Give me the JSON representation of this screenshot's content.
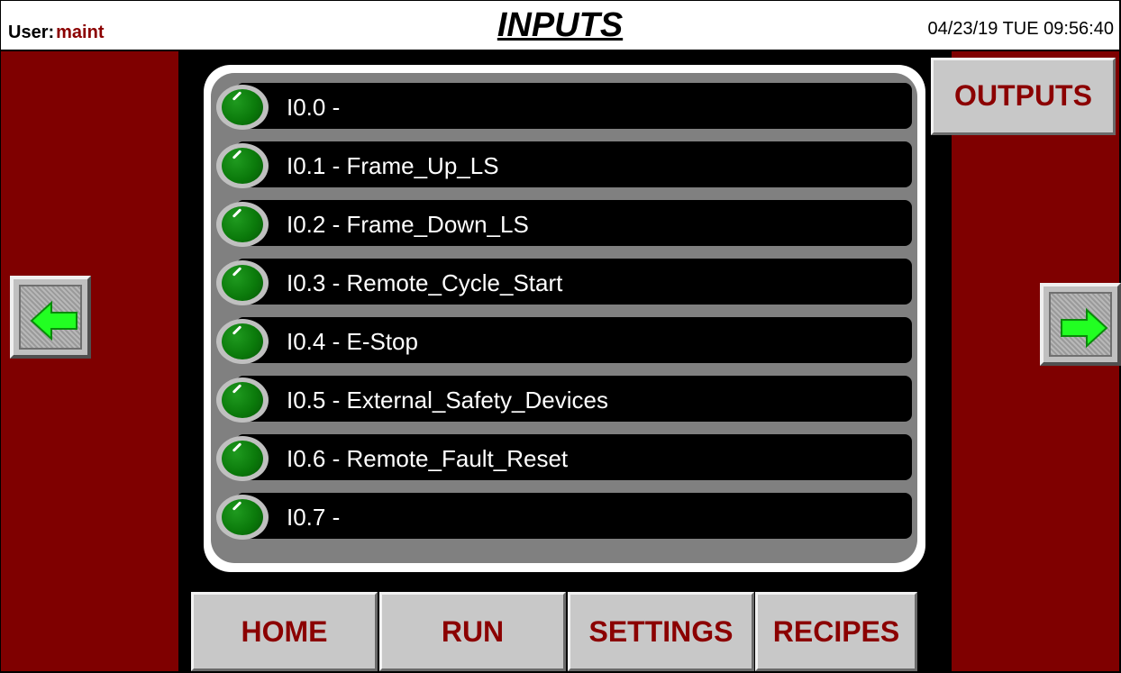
{
  "header": {
    "user_label": "User:",
    "user_name": "maint",
    "title": "INPUTS",
    "datetime": "04/23/19 TUE  09:56:40"
  },
  "inputs": [
    {
      "label": "I0.0 -",
      "status": "on"
    },
    {
      "label": "I0.1 - Frame_Up_LS",
      "status": "on"
    },
    {
      "label": "I0.2 - Frame_Down_LS",
      "status": "on"
    },
    {
      "label": "I0.3 - Remote_Cycle_Start",
      "status": "on"
    },
    {
      "label": "I0.4 - E-Stop",
      "status": "on"
    },
    {
      "label": "I0.5 - External_Safety_Devices",
      "status": "on"
    },
    {
      "label": "I0.6 - Remote_Fault_Reset",
      "status": "on"
    },
    {
      "label": "I0.7 -",
      "status": "on"
    }
  ],
  "buttons": {
    "outputs": "OUTPUTS",
    "prev_icon": "left-arrow-icon",
    "next_icon": "right-arrow-icon"
  },
  "nav": {
    "home": "HOME",
    "run": "RUN",
    "settings": "SETTINGS",
    "recipes": "RECIPES"
  },
  "colors": {
    "panel_red": "#7f0000",
    "label_red": "#8b0000",
    "lamp_green": "#0b7a0b",
    "arrow_green": "#22ff22"
  }
}
